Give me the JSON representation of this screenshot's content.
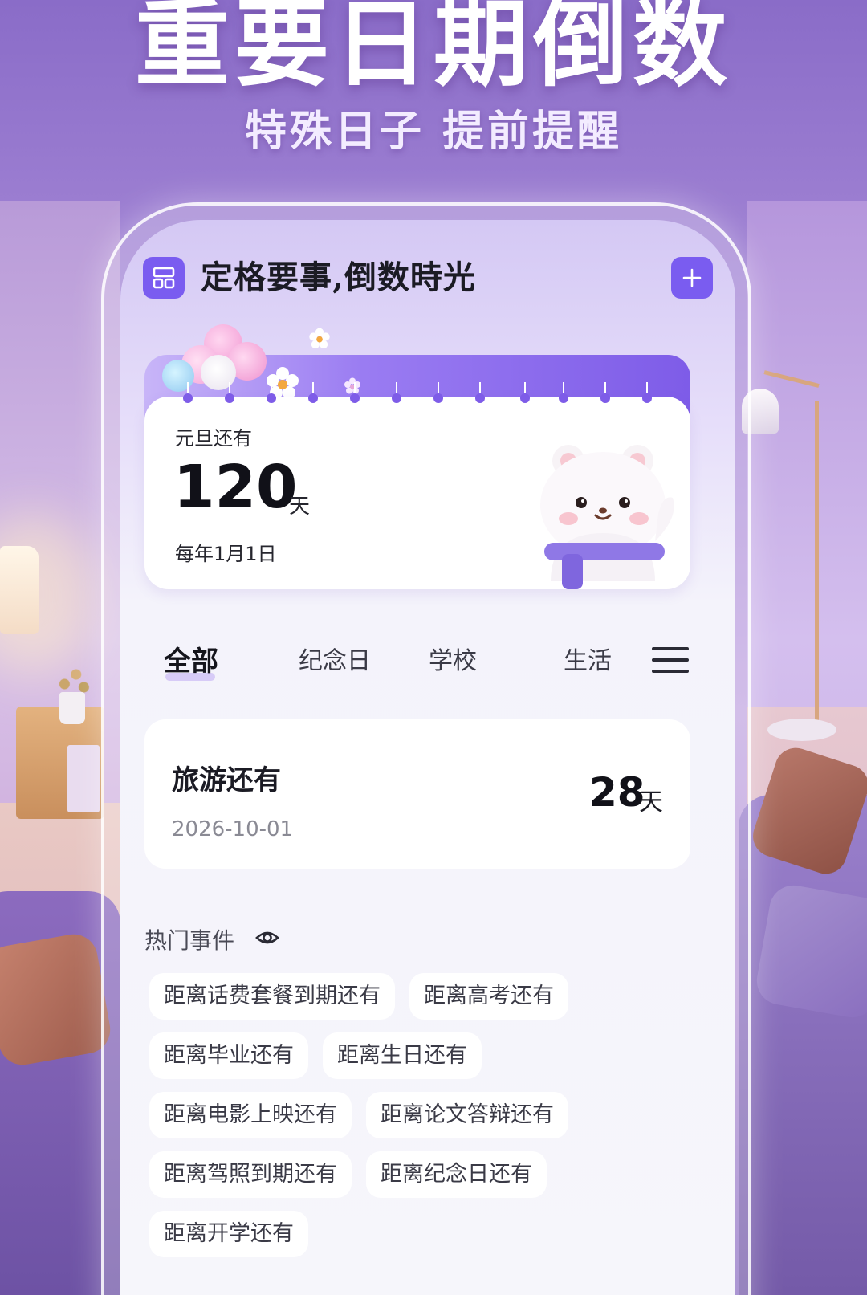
{
  "promo": {
    "headline": "重要日期倒数",
    "subheadline": "特殊日子 提前提醒"
  },
  "app": {
    "title": "定格要事,倒数時光",
    "header_icons": [
      "layout-grid-icon",
      "plus-icon"
    ]
  },
  "hero": {
    "label": "元旦还有",
    "days": "120",
    "unit": "天",
    "repeat": "每年1月1日"
  },
  "tabs": {
    "items": [
      "全部",
      "纪念日",
      "学校",
      "生活"
    ],
    "active": "全部",
    "more_icon": "menu-icon"
  },
  "event": {
    "title": "旅游还有",
    "date": "2026-10-01",
    "days": "28",
    "unit": "天"
  },
  "hot": {
    "title": "热门事件",
    "icon": "eye-icon",
    "chips": [
      "距离话费套餐到期还有",
      "距离高考还有",
      "距离毕业还有",
      "距离生日还有",
      "距离电影上映还有",
      "距离论文答辩还有",
      "距离驾照到期还有",
      "距离纪念日还有",
      "距离开学还有"
    ]
  },
  "colors": {
    "accent": "#7a5cf0",
    "background_top": "#8a6cc8",
    "card": "#ffffff"
  }
}
